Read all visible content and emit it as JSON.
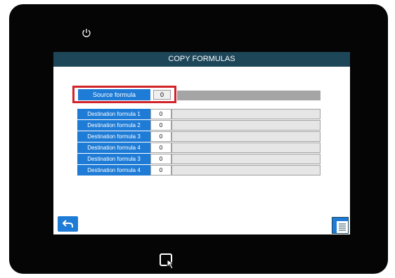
{
  "screen": {
    "title": "COPY FORMULAS"
  },
  "source": {
    "label": "Source formula",
    "value": "0"
  },
  "destinations": [
    {
      "label": "Destination formula 1",
      "value": "0"
    },
    {
      "label": "Destination formula 2",
      "value": "0"
    },
    {
      "label": "Destination formula 3",
      "value": "0"
    },
    {
      "label": "Destination formula 4",
      "value": "0"
    },
    {
      "label": "Destination formula 3",
      "value": "0"
    },
    {
      "label": "Destination formula 4",
      "value": "0"
    }
  ],
  "icons": {
    "power": "power-icon",
    "back": "back-arrow-icon",
    "menu": "menu-icon",
    "touch": "touch-icon"
  },
  "colors": {
    "title_bar": "#1d4659",
    "label_blue": "#1e7bd6",
    "highlight_red": "#d2232a",
    "device": "#050505"
  }
}
